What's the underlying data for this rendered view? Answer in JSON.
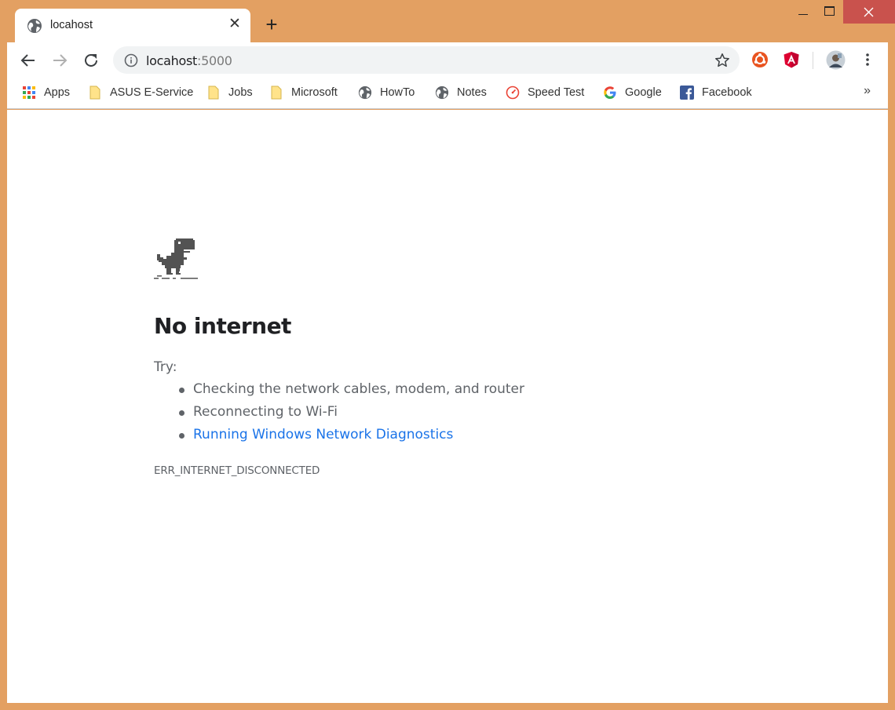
{
  "tab": {
    "title": "locahost",
    "close": "✕",
    "new_tab": "+"
  },
  "address": {
    "host": "locahost",
    "port": ":5000"
  },
  "bookmarks": [
    {
      "label": "Apps",
      "icon": "apps-grid-icon"
    },
    {
      "label": "ASUS E-Service",
      "icon": "folder-icon"
    },
    {
      "label": "Jobs",
      "icon": "folder-icon"
    },
    {
      "label": "Microsoft",
      "icon": "folder-icon"
    },
    {
      "label": "HowTo",
      "icon": "globe-icon"
    },
    {
      "label": "Notes",
      "icon": "globe-icon"
    },
    {
      "label": "Speed Test",
      "icon": "speedometer-icon"
    },
    {
      "label": "Google",
      "icon": "google-g-icon"
    },
    {
      "label": "Facebook",
      "icon": "facebook-icon"
    }
  ],
  "bookmarks_overflow": "»",
  "error": {
    "heading": "No internet",
    "try_label": "Try:",
    "suggestions": [
      "Checking the network cables, modem, and router",
      "Reconnecting to Wi-Fi",
      "Running Windows Network Diagnostics"
    ],
    "code": "ERR_INTERNET_DISCONNECTED"
  },
  "colors": {
    "window_frame": "#e3a062",
    "close_button": "#c9524d",
    "link": "#1a73e8",
    "text_secondary": "#5f6368"
  }
}
